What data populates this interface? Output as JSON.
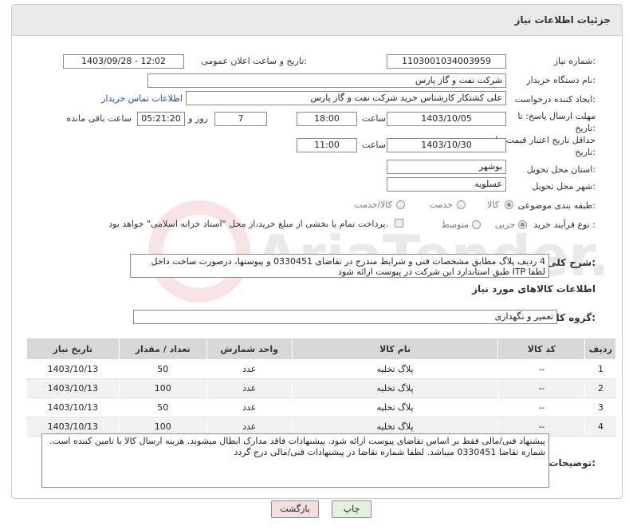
{
  "header": {
    "title": "جزئیات اطلاعات نیاز"
  },
  "fields": {
    "need_number_label": "شماره نیاز:",
    "need_number": "1103001034003959",
    "announce_label": "تاریخ و ساعت اعلان عمومی:",
    "announce_value": "1403/09/28 - 12:02",
    "buyer_org_label": "نام دستگاه خریدار:",
    "buyer_org": "شرکت نفت و گاز پارس",
    "requester_label": "ایجاد کننده درخواست:",
    "requester": "علی کشتکار کارشناس خرید شرکت نفت و گاز پارس",
    "contact_link": "اطلاعات تماس خریدار",
    "deadline_label": "مهلت ارسال پاسخ: تا تاریخ:",
    "deadline_date": "1403/10/05",
    "time_label": "ساعت",
    "deadline_time": "18:00",
    "days_count": "7",
    "days_label": "روز و",
    "remaining_time": "05:21:20",
    "remaining_label": "ساعت باقی مانده",
    "validity_label": "حداقل تاریخ اعتبار قیمت: تا تاریخ:",
    "validity_date": "1403/10/30",
    "validity_time": "11:00",
    "province_label": "استان محل تحویل:",
    "province": "بوشهر",
    "city_label": "شهر محل تحویل:",
    "city": "عسلویه",
    "category_label": "طبقه بندی موضوعی:",
    "category_options": [
      "کالا",
      "خدمت",
      "کالا/خدمت"
    ],
    "process_label": "نوع فرآیند خرید :",
    "process_options": [
      "جزیی",
      "متوسط"
    ],
    "payment_note": "پرداخت تمام یا بخشی از مبلغ خرید،از محل \"اسناد خزانه اسلامی\" خواهد بود.",
    "summary_label": "شرح کلی نیاز:",
    "summary": "4 ردیف پلاگ مطابق مشخصات فنی و شرایط مندرج در تقاضای 0330451 و پیوستها، درصورت ساخت داخل لطفا ITP طبق استاندارد این شرکت در پیوست ارائه شود",
    "goods_info_title": "اطلاعات کالاهای مورد نیاز",
    "goods_group_label": "گروه کالا:",
    "goods_group": "تعمیر و نگهداری",
    "buyer_notes_label": "توضیحات خریدار:",
    "buyer_notes": "پیشنهاد فنی/مالی فقط بر اساس تقاضای پیوست ارائه شود. پیشنهادات فاقد مدارک ابطال میشوند. هزینه ارسال کالا با تامین کننده است. شماره تقاضا 0330451 میباشد. لطفا شماره تقاضا در پیشنهادات فنی/مالی درج گردد"
  },
  "table": {
    "headers": [
      "ردیف",
      "کد کالا",
      "نام کالا",
      "واحد شمارش",
      "تعداد / مقدار",
      "تاریخ نیاز"
    ],
    "rows": [
      [
        "1",
        "--",
        "پلاگ تخلیه",
        "عدد",
        "50",
        "1403/10/13"
      ],
      [
        "2",
        "--",
        "پلاگ تخلیه",
        "عدد",
        "100",
        "1403/10/13"
      ],
      [
        "3",
        "--",
        "پلاگ تخلیه",
        "عدد",
        "50",
        "1403/10/13"
      ],
      [
        "4",
        "--",
        "پلاگ تخلیه",
        "عدد",
        "100",
        "1403/10/13"
      ]
    ]
  },
  "buttons": {
    "print": "چاپ",
    "back": "بازگشت"
  },
  "watermark": {
    "text": "AriaTender.net"
  },
  "colors": {
    "header_bg": "#e9e9e9",
    "link": "#1f4fb5",
    "back_button": "#f7dede",
    "print_button": "#e3f2dc"
  }
}
